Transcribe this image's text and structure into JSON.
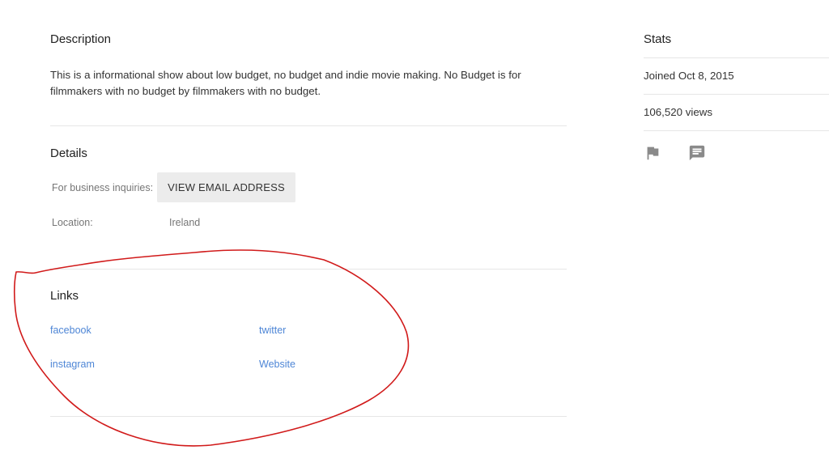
{
  "description": {
    "title": "Description",
    "text": "This is a informational show about low budget, no budget and indie movie making. No Budget is for filmmakers with no budget by filmmakers with no budget."
  },
  "details": {
    "title": "Details",
    "business_label": "For business inquiries:",
    "email_button_label": "VIEW EMAIL ADDRESS",
    "location_label": "Location:",
    "location_value": "Ireland"
  },
  "links": {
    "title": "Links",
    "items": [
      {
        "label": "facebook"
      },
      {
        "label": "twitter"
      },
      {
        "label": "instagram"
      },
      {
        "label": "Website"
      }
    ]
  },
  "stats": {
    "title": "Stats",
    "joined": "Joined Oct 8, 2015",
    "views": "106,520 views"
  },
  "icons": {
    "flag": "flag-icon",
    "message": "message-icon"
  },
  "colors": {
    "link": "#4e86d6",
    "annotation": "#d11a1a",
    "button_bg": "#ececec"
  }
}
